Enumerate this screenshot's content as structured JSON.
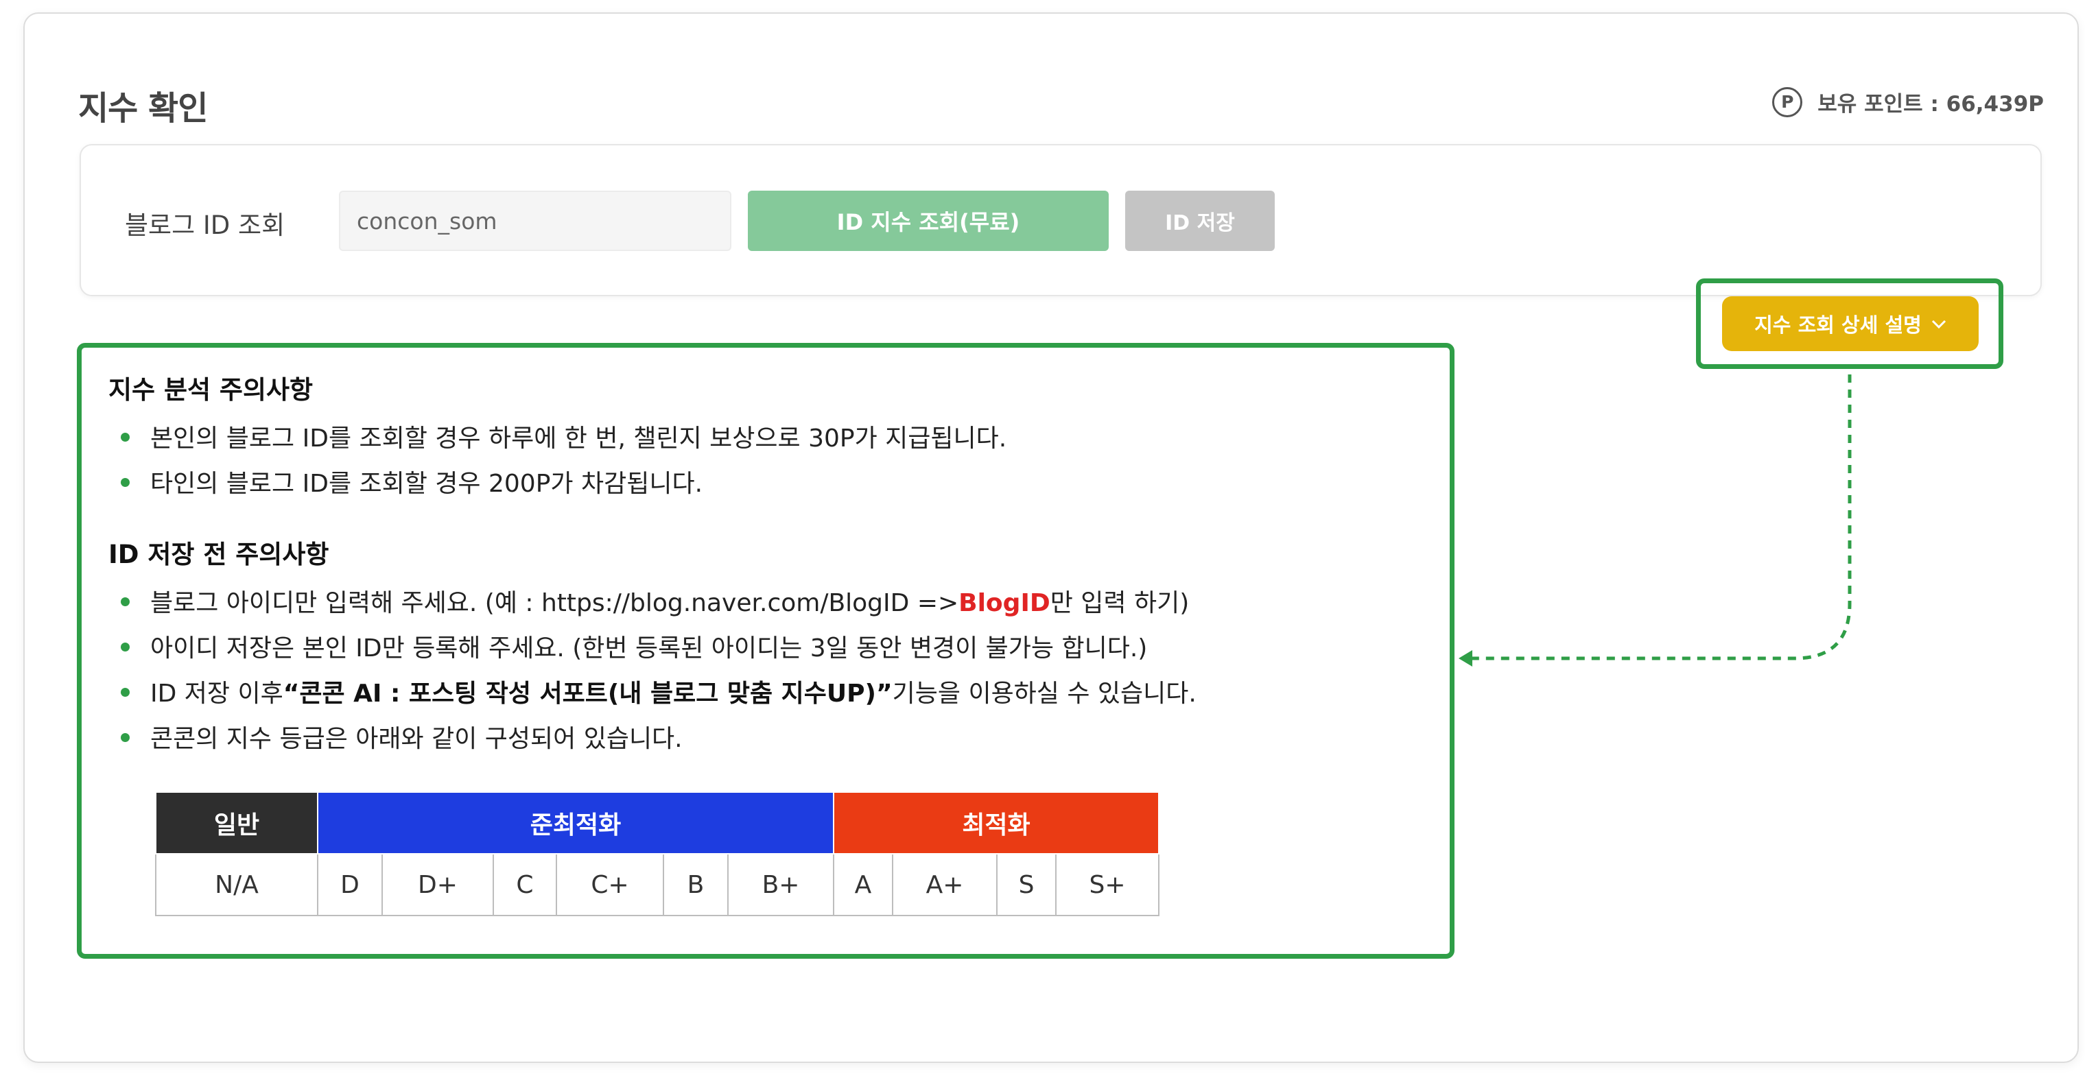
{
  "page": {
    "title": "지수 확인",
    "points_icon": "P",
    "points_label": "보유 포인트 : 66,439P"
  },
  "search": {
    "label": "블로그 ID 조회",
    "input_value": "concon_som",
    "lookup_button": "ID 지수 조회(무료)",
    "save_button": "ID 저장"
  },
  "detail_button": {
    "label": "지수 조회 상세 설명",
    "icon": "chevron-down-icon"
  },
  "notice": {
    "analysis_title": "지수 분석 주의사항",
    "analysis_items": [
      "본인의 블로그 ID를 조회할 경우 하루에 한 번, 챌린지 보상으로 30P가 지급됩니다.",
      "타인의 블로그 ID를 조회할 경우 200P가 차감됩니다."
    ],
    "save_title": "ID 저장 전 주의사항",
    "save_item1_pre": "블로그 아이디만 입력해 주세요. (예 : https://blog.naver.com/BlogID =>",
    "save_item1_red": "BlogID",
    "save_item1_post": "만 입력 하기)",
    "save_item2": "아이디 저장은 본인 ID만 등록해 주세요. (한번 등록된 아이디는 3일 동안 변경이 불가능 합니다.)",
    "save_item3_pre": "ID 저장 이후",
    "save_item3_bold": "“콘콘 AI : 포스팅 작성 서포트(내 블로그 맞춤 지수UP)”",
    "save_item3_post": "기능을 이용하실 수 있습니다.",
    "save_item4": "콘콘의 지수 등급은 아래와 같이 구성되어 있습니다."
  },
  "grade_table": {
    "headers": [
      "일반",
      "준최적화",
      "최적화"
    ],
    "grades": [
      "N/A",
      "D",
      "D+",
      "C",
      "C+",
      "B",
      "B+",
      "A",
      "A+",
      "S",
      "S+"
    ]
  },
  "colors": {
    "accent_green": "#2f9e47",
    "lookup_button": "#85c99a",
    "detail_button": "#e5b40b",
    "semi_optimized": "#1e3de0",
    "optimized": "#ea3b14",
    "general": "#2e2e2e"
  }
}
